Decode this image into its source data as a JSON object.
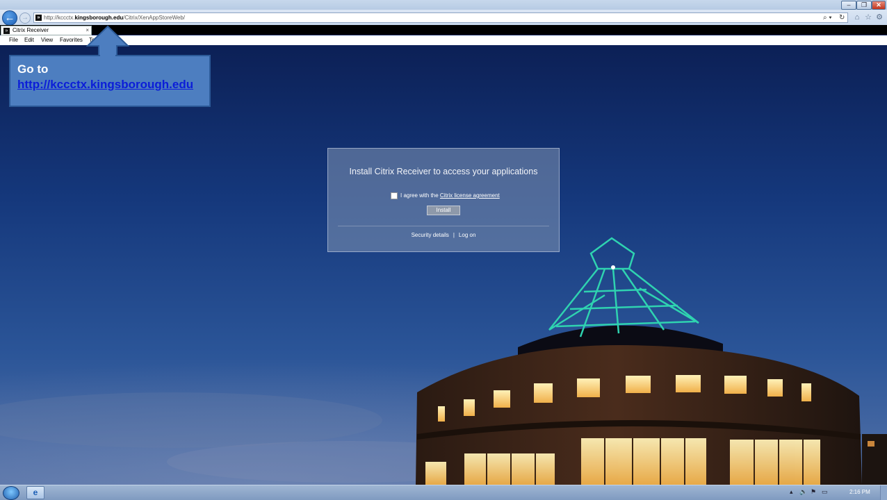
{
  "browser": {
    "address_prefix": "http://kccctx.",
    "address_host": "kingsborough.edu",
    "address_path": "/Citrix/XenAppStoreWeb/",
    "tab_title": "Citrix Receiver",
    "tab_close": "×",
    "menu": [
      "File",
      "Edit",
      "View",
      "Favorites",
      "To"
    ],
    "search_glyph": "⌕ ▾",
    "refresh_glyph": "↻"
  },
  "callout": {
    "title": "Go to",
    "link": "http://kccctx.kingsborough.edu"
  },
  "dialog": {
    "title": "Install Citrix Receiver to access your applications",
    "agree_prefix": "I agree with the ",
    "license_link": "Citrix license agreement",
    "install_label": "Install",
    "security_details": "Security details",
    "separator": "|",
    "log_on": "Log on"
  },
  "taskbar": {
    "clock": "2:16 PM"
  },
  "colors": {
    "callout_fill": "#4d7ec0",
    "callout_link": "#0b1dd8",
    "sky_top": "#0c2056",
    "sky_bottom": "#5472a8",
    "tower_glow": "#2fd3b0"
  },
  "icons": {
    "back": "back-arrow-icon",
    "forward": "forward-arrow-icon",
    "home": "home-icon",
    "favorites": "star-icon",
    "tools": "gear-icon"
  }
}
